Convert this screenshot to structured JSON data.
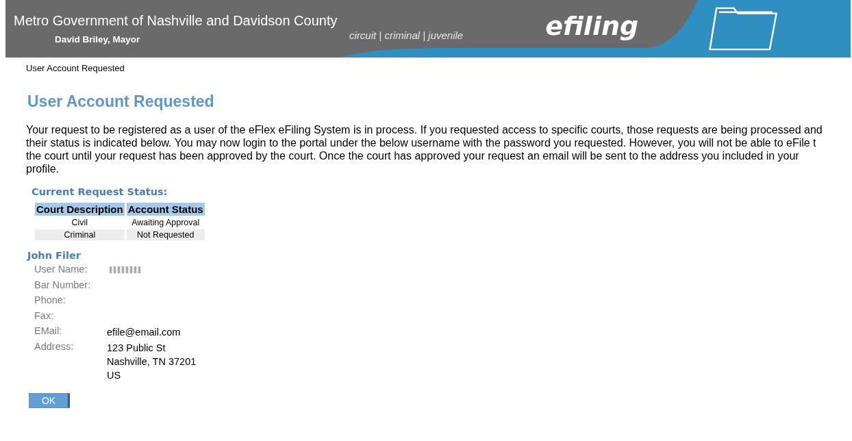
{
  "header": {
    "title": "Metro Government of Nashville and Davidson County",
    "subtitle": "David Briley, Mayor",
    "tagline": "circuit | criminal | juvenile",
    "brand": "efiling"
  },
  "breadcrumb": "User Account Requested",
  "heading": "User Account Requested",
  "message": "Your request to be registered as a user of the eFlex eFiling System is in process. If you requested access to specific courts, those requests are being processed and\ntheir status is indicated below. You may now login to the portal under the below username with the password you requested. However, you will not be able to eFile t\nthe court until your request has been approved by the court. Once the court has approved your request an email will be sent to the address you included in your\nprofile.",
  "status": {
    "title": "Current Request Status:",
    "columns": [
      "Court Description",
      "Account Status"
    ],
    "rows": [
      [
        "Civil",
        "Awaiting Approval"
      ],
      [
        "Criminal",
        "Not Requested"
      ]
    ]
  },
  "profile": {
    "name": "John Filer",
    "fields": [
      {
        "label": "User Name:",
        "kind": "redacted"
      },
      {
        "label": "Bar Number:",
        "kind": "text"
      },
      {
        "label": "Phone:",
        "kind": "text"
      },
      {
        "label": "Fax:",
        "kind": "text"
      },
      {
        "label": "EMail:",
        "kind": "text",
        "lines": [
          "efile@email.com"
        ]
      },
      {
        "label": "Address:",
        "kind": "text",
        "lines": [
          "123 Public St",
          "Nashville, TN 37201",
          "US"
        ]
      }
    ]
  },
  "ok_button": "OK"
}
